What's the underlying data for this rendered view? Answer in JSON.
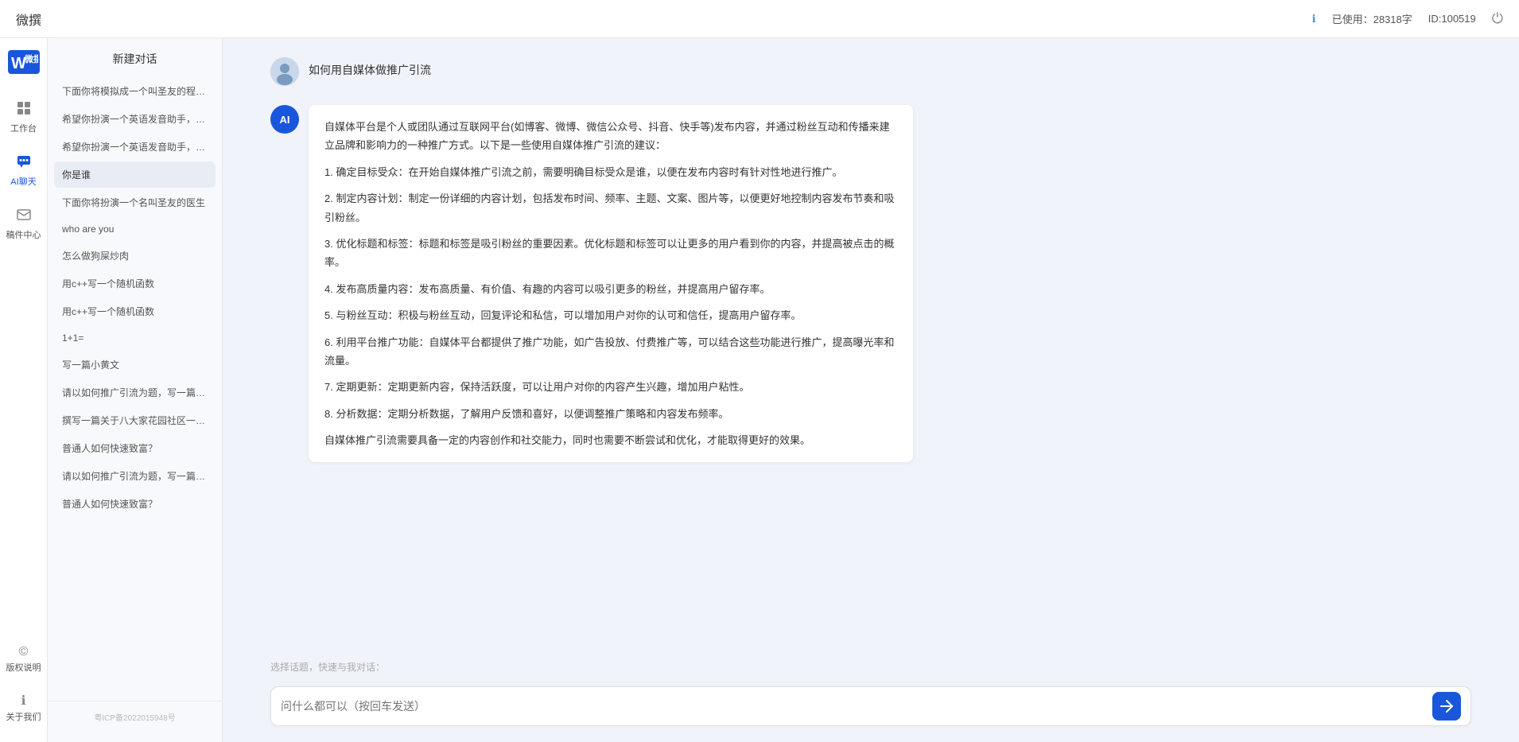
{
  "topbar": {
    "title": "微撰",
    "usage_label": "已使用：28318字",
    "id_label": "ID:100519"
  },
  "logo": {
    "text": "W"
  },
  "nav": {
    "items": [
      {
        "id": "workbench",
        "label": "工作台",
        "icon": "⊞"
      },
      {
        "id": "ai-chat",
        "label": "AI聊天",
        "icon": "💬",
        "active": true
      },
      {
        "id": "mailbox",
        "label": "稿件中心",
        "icon": "📄"
      }
    ],
    "bottom_items": [
      {
        "id": "copyright",
        "label": "版权说明",
        "icon": "©"
      },
      {
        "id": "about",
        "label": "关于我们",
        "icon": "ℹ"
      }
    ]
  },
  "history": {
    "new_chat": "新建对话",
    "items": [
      {
        "id": 1,
        "text": "下面你将模拟成一个叫圣友的程序员、我说..."
      },
      {
        "id": 2,
        "text": "希望你扮演一个英语发音助手，我提供给你..."
      },
      {
        "id": 3,
        "text": "希望你扮演一个英语发音助手，我提供给你..."
      },
      {
        "id": 4,
        "text": "你是谁",
        "active": true
      },
      {
        "id": 5,
        "text": "下面你将扮演一个名叫圣友的医生"
      },
      {
        "id": 6,
        "text": "who are you"
      },
      {
        "id": 7,
        "text": "怎么做狗屎炒肉"
      },
      {
        "id": 8,
        "text": "用c++写一个随机函数"
      },
      {
        "id": 9,
        "text": "用c++写一个随机函数"
      },
      {
        "id": 10,
        "text": "1+1="
      },
      {
        "id": 11,
        "text": "写一篇小黄文"
      },
      {
        "id": 12,
        "text": "请以如何推广引流为题，写一篇大纲"
      },
      {
        "id": 13,
        "text": "撰写一篇关于八大家花园社区一刻钟便民生..."
      },
      {
        "id": 14,
        "text": "普通人如何快速致富？"
      },
      {
        "id": 15,
        "text": "请以如何推广引流为题，写一篇大纲"
      },
      {
        "id": 16,
        "text": "普通人如何快速致富？"
      }
    ],
    "footer_items": [
      {
        "id": "copyright-footer",
        "label": "版权说明",
        "icon": "©"
      },
      {
        "id": "about-footer",
        "label": "关于我们",
        "icon": "ℹ"
      }
    ],
    "icp": "粤ICP备2022015948号"
  },
  "chat": {
    "user_message": "如何用自媒体做推广引流",
    "ai_response": {
      "paragraphs": [
        "自媒体平台是个人或团队通过互联网平台(如博客、微博、微信公众号、抖音、快手等)发布内容，并通过粉丝互动和传播来建立品牌和影响力的一种推广方式。以下是一些使用自媒体推广引流的建议：",
        "1. 确定目标受众：在开始自媒体推广引流之前，需要明确目标受众是谁，以便在发布内容时有针对性地进行推广。",
        "2. 制定内容计划：制定一份详细的内容计划，包括发布时间、频率、主题、文案、图片等，以便更好地控制内容发布节奏和吸引粉丝。",
        "3. 优化标题和标签：标题和标签是吸引粉丝的重要因素。优化标题和标签可以让更多的用户看到你的内容，并提高被点击的概率。",
        "4. 发布高质量内容：发布高质量、有价值、有趣的内容可以吸引更多的粉丝，并提高用户留存率。",
        "5. 与粉丝互动：积极与粉丝互动，回复评论和私信，可以增加用户对你的认可和信任，提高用户留存率。",
        "6. 利用平台推广功能：自媒体平台都提供了推广功能，如广告投放、付费推广等，可以结合这些功能进行推广，提高曝光率和流量。",
        "7. 定期更新：定期更新内容，保持活跃度，可以让用户对你的内容产生兴趣，增加用户粘性。",
        "8. 分析数据：定期分析数据，了解用户反馈和喜好，以便调整推广策略和内容发布频率。",
        "自媒体推广引流需要具备一定的内容创作和社交能力，同时也需要不断尝试和优化，才能取得更好的效果。"
      ]
    },
    "quick_select_label": "选择话题，快速与我对话：",
    "input_placeholder": "问什么都可以（按回车发送）"
  }
}
